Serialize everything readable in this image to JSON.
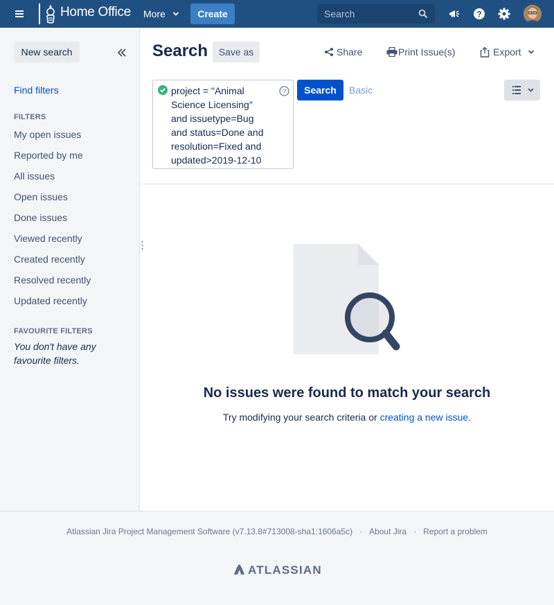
{
  "topnav": {
    "brand": "Home Office",
    "more_label": "More",
    "create_label": "Create",
    "search_placeholder": "Search",
    "icons": [
      "app-switcher-icon",
      "home-office-crest-icon",
      "megaphone-icon",
      "help-icon",
      "gear-icon",
      "avatar"
    ]
  },
  "sidebar": {
    "new_search_label": "New search",
    "find_filters_label": "Find filters",
    "filters_heading": "FILTERS",
    "filters": [
      "My open issues",
      "Reported by me",
      "All issues",
      "Open issues",
      "Done issues",
      "Viewed recently",
      "Created recently",
      "Resolved recently",
      "Updated recently"
    ],
    "favourites_heading": "FAVOURITE FILTERS",
    "favourites_empty": "You don't have any favourite filters."
  },
  "main": {
    "title": "Search",
    "save_as_label": "Save as",
    "share_label": "Share",
    "print_label": "Print Issue(s)",
    "export_label": "Export",
    "jql": "project = \"Animal\nScience Licensing\"\nand issuetype=Bug\nand status=Done and\nresolution=Fixed and\nupdated>2019-12-10",
    "search_button_label": "Search",
    "basic_label": "Basic",
    "empty_title": "No issues were found to match your search",
    "empty_sub_prefix": "Try modifying your search criteria or ",
    "empty_sub_link": "creating a new issue",
    "empty_sub_suffix": "."
  },
  "footer": {
    "software": "Atlassian Jira Project Management Software (v7.13.8#713008-sha1:1606a5c)",
    "separator": "·",
    "about": "About Jira",
    "report": "Report a problem",
    "brand": "ATLASSIAN"
  },
  "colors": {
    "topnav_bg": "#205081",
    "create_bg": "#3b7fc4",
    "primary": "#0052cc",
    "success": "#36b37e",
    "sidebar_bg": "#f4f5f7"
  }
}
